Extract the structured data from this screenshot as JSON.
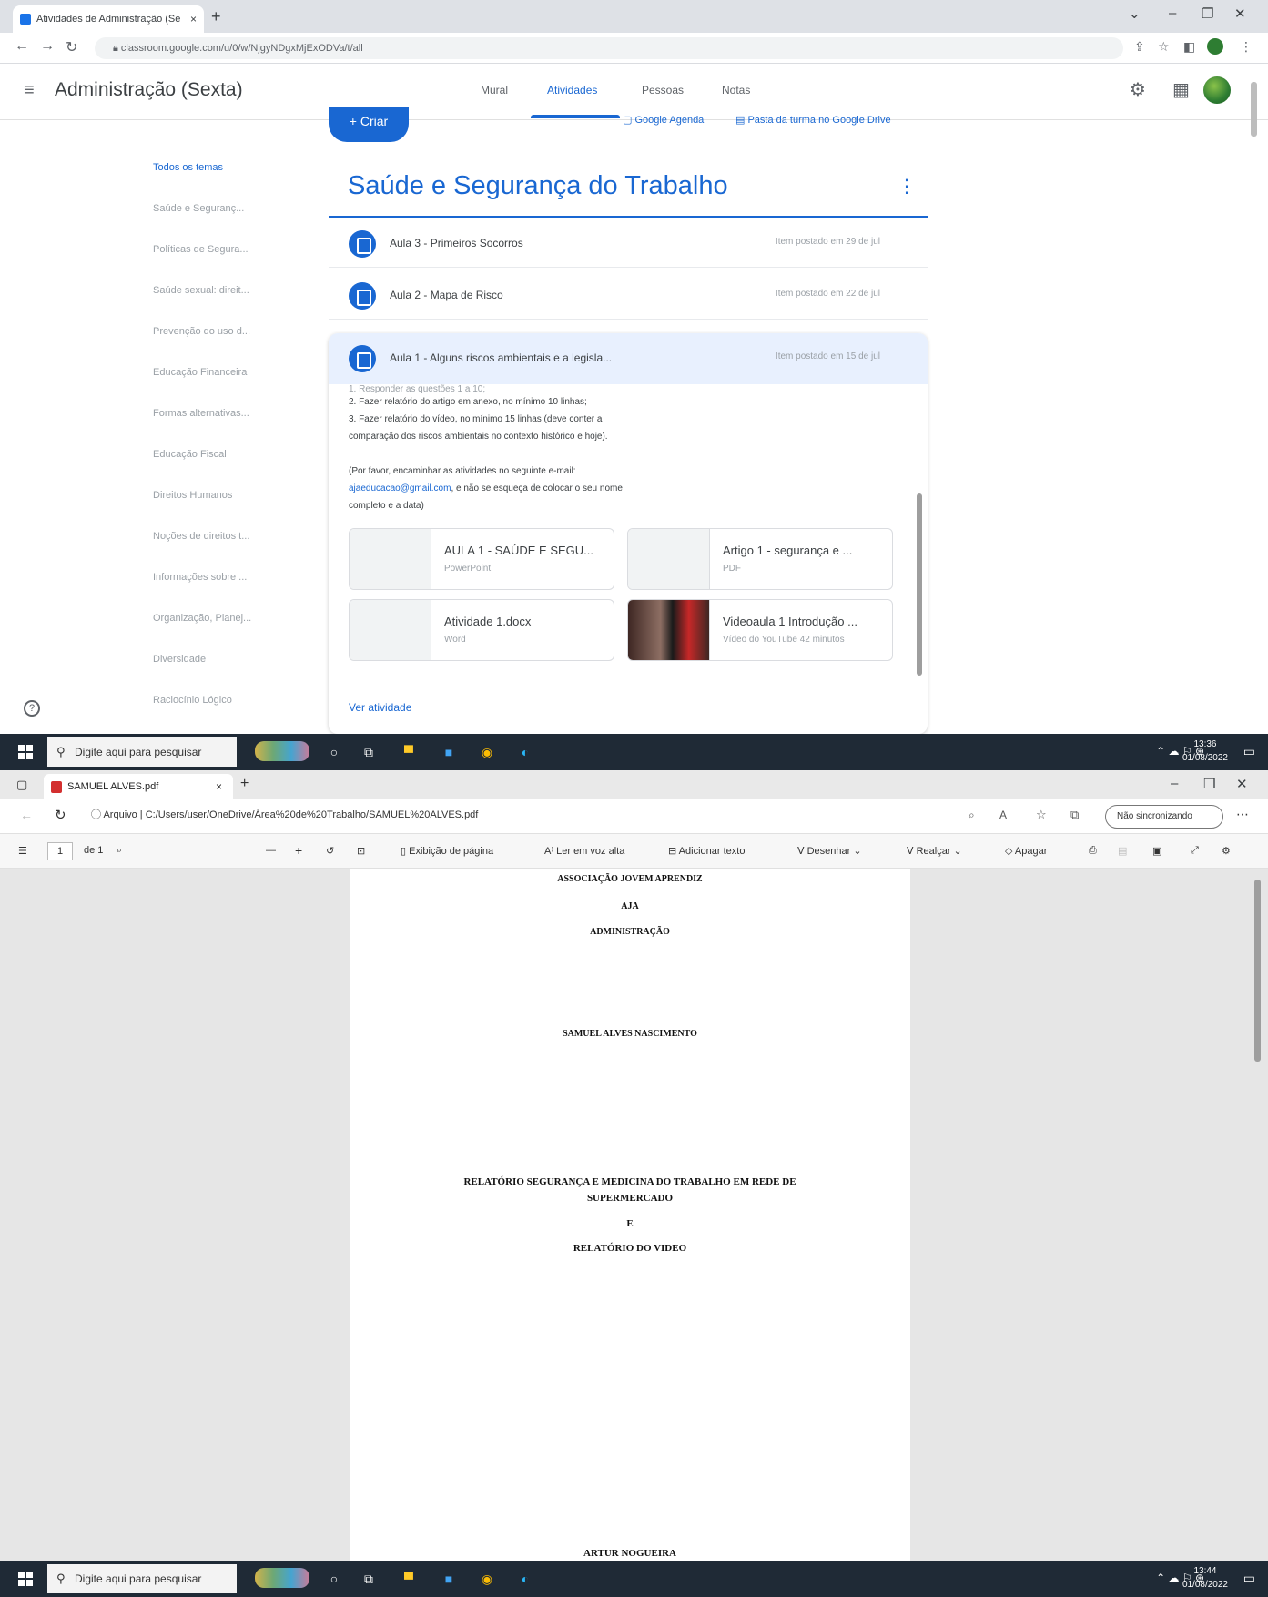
{
  "top_window": {
    "browser": {
      "tab_title": "Atividades de Administração (Se",
      "tab_close": "×",
      "new_tab": "+",
      "url": "classroom.google.com/u/0/w/NjgyNDgxMjExODVa/t/all"
    },
    "classroom": {
      "menu_icon": "≡",
      "class_title": "Administração (Sexta)",
      "tabs": [
        "Mural",
        "Atividades",
        "Pessoas",
        "Notas"
      ],
      "active_tab": "Atividades",
      "create_label": "+ Criar",
      "calendar_link": "Google Agenda",
      "drive_link": "Pasta da turma no Google Drive",
      "topics": [
        "Todos os temas",
        "Saúde e Seguranç...",
        "Políticas de Segura...",
        "Saúde sexual: direit...",
        "Prevenção do uso d...",
        "Educação Financeira",
        "Formas alternativas...",
        "Educação Fiscal",
        "Direitos Humanos",
        "Noções de direitos t...",
        "Informações sobre ...",
        "Organização, Planej...",
        "Diversidade",
        "Raciocínio Lógico"
      ],
      "topic_title": "Saúde e Segurança do Trabalho",
      "kebab": "⋮",
      "items": [
        {
          "title": "Aula 3 - Primeiros Socorros",
          "meta": "Item postado em 29 de jul"
        },
        {
          "title": "Aula 2 - Mapa de Risco",
          "meta": "Item postado em 22 de jul"
        }
      ],
      "expanded": {
        "title": "Aula 1 - Alguns riscos ambientais e a legisla...",
        "meta": "Item postado em 15 de jul",
        "lines": [
          "1. Responder as questões 1 a 10;",
          "2. Fazer relatório do artigo em anexo, no mínimo 10 linhas;",
          "3. Fazer relatório do vídeo, no mínimo 15 linhas (deve conter a",
          "comparação dos riscos ambientais no contexto histórico e hoje)."
        ],
        "email_intro": "(Por favor, encaminhar as atividades no seguinte e-mail:",
        "email": "ajaeducacao@gmail.com",
        "email_rest": ", e não se esqueça de colocar o seu nome",
        "email_end": "completo e a data)",
        "attachments": [
          {
            "title": "AULA 1 - SAÚDE E SEGU...",
            "type": "PowerPoint"
          },
          {
            "title": "Artigo 1 - segurança e ...",
            "type": "PDF"
          },
          {
            "title": "Atividade 1.docx",
            "type": "Word"
          },
          {
            "title": "Videoaula 1 Introdução ...",
            "type": "Vídeo do YouTube   42 minutos"
          }
        ],
        "view_link": "Ver atividade"
      },
      "help": "?"
    },
    "taskbar": {
      "search_placeholder": "Digite aqui para pesquisar",
      "time": "13:36",
      "date": "01/08/2022"
    }
  },
  "bottom_window": {
    "browser": {
      "tab_title": "SAMUEL ALVES.pdf",
      "tab_close": "×",
      "new_tab": "+",
      "url_prefix": "Arquivo",
      "url": "C:/Users/user/OneDrive/Área%20de%20Trabalho/SAMUEL%20ALVES.pdf",
      "sync_label": "Não sincronizando"
    },
    "pdf_toolbar": {
      "page_current": "1",
      "page_total": "de 1",
      "zoom_out": "—",
      "zoom_in": "+",
      "page_view": "Exibição de página",
      "read_aloud": "Ler em voz alta",
      "add_text": "Adicionar texto",
      "draw": "Desenhar",
      "highlight": "Realçar",
      "erase": "Apagar"
    },
    "document": {
      "org": "ASSOCIAÇÃO JOVEM APRENDIZ",
      "acronym": "AJA",
      "dept": "ADMINISTRAÇÃO",
      "author": "SAMUEL ALVES NASCIMENTO",
      "title_line1": "RELATÓRIO SEGURANÇA E MEDICINA DO TRABALHO EM REDE DE",
      "title_line2": "SUPERMERCADO",
      "connector": "E",
      "title2": "RELATÓRIO DO VIDEO",
      "footer": "ARTUR NOGUEIRA"
    },
    "taskbar": {
      "search_placeholder": "Digite aqui para pesquisar",
      "time": "13:44",
      "date": "01/08/2022"
    }
  }
}
